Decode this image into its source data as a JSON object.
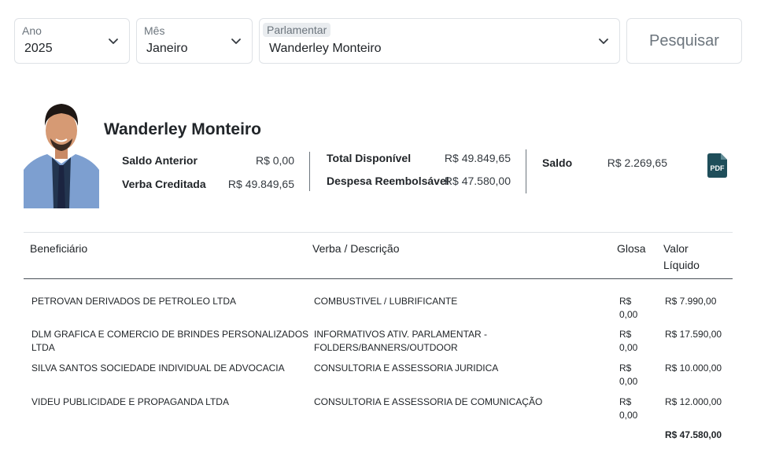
{
  "filters": {
    "ano": {
      "label": "Ano",
      "value": "2025"
    },
    "mes": {
      "label": "Mês",
      "value": "Janeiro"
    },
    "parlamentar": {
      "label": "Parlamentar",
      "value": "Wanderley Monteiro"
    },
    "search_label": "Pesquisar"
  },
  "profile": {
    "name": "Wanderley Monteiro"
  },
  "summary": {
    "saldo_anterior_label": "Saldo Anterior",
    "saldo_anterior_value": "R$ 0,00",
    "verba_creditada_label": "Verba Creditada",
    "verba_creditada_value": "R$ 49.849,65",
    "total_disponivel_label": "Total Disponível",
    "total_disponivel_value": "R$ 49.849,65",
    "despesa_reembolsavel_label": "Despesa Reembolsável",
    "despesa_reembolsavel_value": "R$ 47.580,00",
    "saldo_label": "Saldo",
    "saldo_value": "R$ 2.269,65"
  },
  "table": {
    "headers": {
      "beneficiario": "Beneficiário",
      "verba": "Verba / Descrição",
      "glosa": "Glosa",
      "valor_line1": "Valor",
      "valor_line2": "Líquido"
    },
    "rows": [
      {
        "beneficiario": [
          "PETROVAN DERIVADOS DE PETROLEO LTDA"
        ],
        "verba": [
          "COMBUSTIVEL / LUBRIFICANTE"
        ],
        "glosa": [
          "R$",
          "0,00"
        ],
        "valor": "R$ 7.990,00"
      },
      {
        "beneficiario": [
          "DLM GRAFICA E COMERCIO DE BRINDES PERSONALIZADOS",
          "LTDA"
        ],
        "verba": [
          "INFORMATIVOS ATIV. PARLAMENTAR -",
          "FOLDERS/BANNERS/OUTDOOR"
        ],
        "glosa": [
          "R$",
          "0,00"
        ],
        "valor": "R$ 17.590,00"
      },
      {
        "beneficiario": [
          "SILVA SANTOS SOCIEDADE INDIVIDUAL DE ADVOCACIA"
        ],
        "verba": [
          "CONSULTORIA E ASSESSORIA JURIDICA"
        ],
        "glosa": [
          "R$",
          "0,00"
        ],
        "valor": "R$ 10.000,00"
      },
      {
        "beneficiario": [
          "VIDEU PUBLICIDADE E PROPAGANDA LTDA"
        ],
        "verba": [
          "CONSULTORIA E ASSESSORIA DE COMUNICAÇÃO"
        ],
        "glosa": [
          "R$",
          "0,00"
        ],
        "valor": "R$ 12.000,00"
      }
    ],
    "total": "R$ 47.580,00"
  },
  "colors": {
    "border": "#dee2e6",
    "muted": "#6c757d",
    "text": "#212529",
    "pdf_icon": "#1f4e5a"
  }
}
